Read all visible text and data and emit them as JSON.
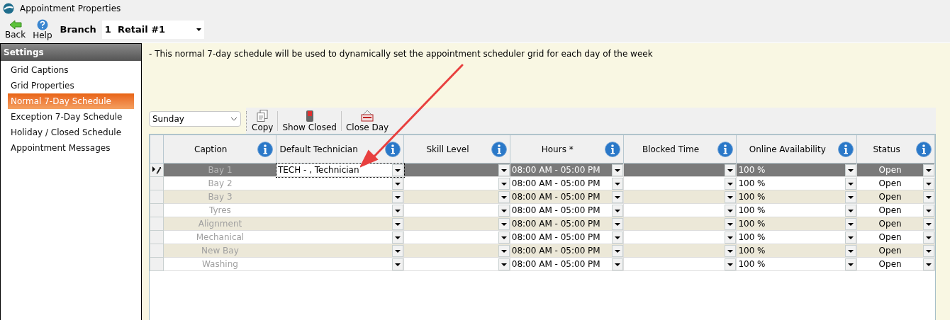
{
  "window": {
    "title": "Appointment Properties"
  },
  "toolbar": {
    "buttons": [
      {
        "label": "Back",
        "kind": "back"
      },
      {
        "label": "Help",
        "kind": "help"
      }
    ],
    "branch_label": "Branch",
    "branch_value": "1  Retail #1"
  },
  "sidebar": {
    "title": "Settings",
    "items": [
      {
        "label": "Grid Captions",
        "selected": false
      },
      {
        "label": "Grid Properties",
        "selected": false
      },
      {
        "label": "Normal 7-Day Schedule",
        "selected": true
      },
      {
        "label": "Exception 7-Day Schedule",
        "selected": false
      },
      {
        "label": "Holiday / Closed Schedule",
        "selected": false
      },
      {
        "label": "Appointment Messages",
        "selected": false
      }
    ]
  },
  "note": "- This normal 7-day schedule will be used to dynamically set the appointment scheduler grid for each day of the week",
  "day_select": {
    "value": "Sunday"
  },
  "actions": [
    {
      "label": "Copy",
      "kind": "copy"
    },
    {
      "label": "Show Closed",
      "kind": "show_closed"
    },
    {
      "label": "Close Day",
      "kind": "close_day"
    }
  ],
  "table": {
    "columns": [
      "Caption",
      "Default Technician",
      "Skill Level",
      "Hours *",
      "Blocked Time",
      "Online Availability",
      "Status"
    ],
    "rows": [
      {
        "caption": "Bay 1",
        "technician": "TECH - , Technician",
        "hours": "08:00 AM - 05:00 PM",
        "online": "100 %",
        "status": "Open",
        "selected": true
      },
      {
        "caption": "Bay 2",
        "hours": "08:00 AM - 05:00 PM",
        "online": "100 %",
        "status": "Open",
        "selected": false
      },
      {
        "caption": "Bay 3",
        "hours": "08:00 AM - 05:00 PM",
        "online": "100 %",
        "status": "Open",
        "selected": false
      },
      {
        "caption": "Tyres",
        "hours": "08:00 AM - 05:00 PM",
        "online": "100 %",
        "status": "Open",
        "selected": false
      },
      {
        "caption": "Alignment",
        "hours": "08:00 AM - 05:00 PM",
        "online": "100 %",
        "status": "Open",
        "selected": false
      },
      {
        "caption": "Mechanical",
        "hours": "08:00 AM - 05:00 PM",
        "online": "100 %",
        "status": "Open",
        "selected": false
      },
      {
        "caption": "New Bay",
        "hours": "08:00 AM - 05:00 PM",
        "online": "100 %",
        "status": "Open",
        "selected": false
      },
      {
        "caption": "Washing",
        "hours": "08:00 AM - 05:00 PM",
        "online": "100 %",
        "status": "Open",
        "selected": false
      }
    ]
  }
}
